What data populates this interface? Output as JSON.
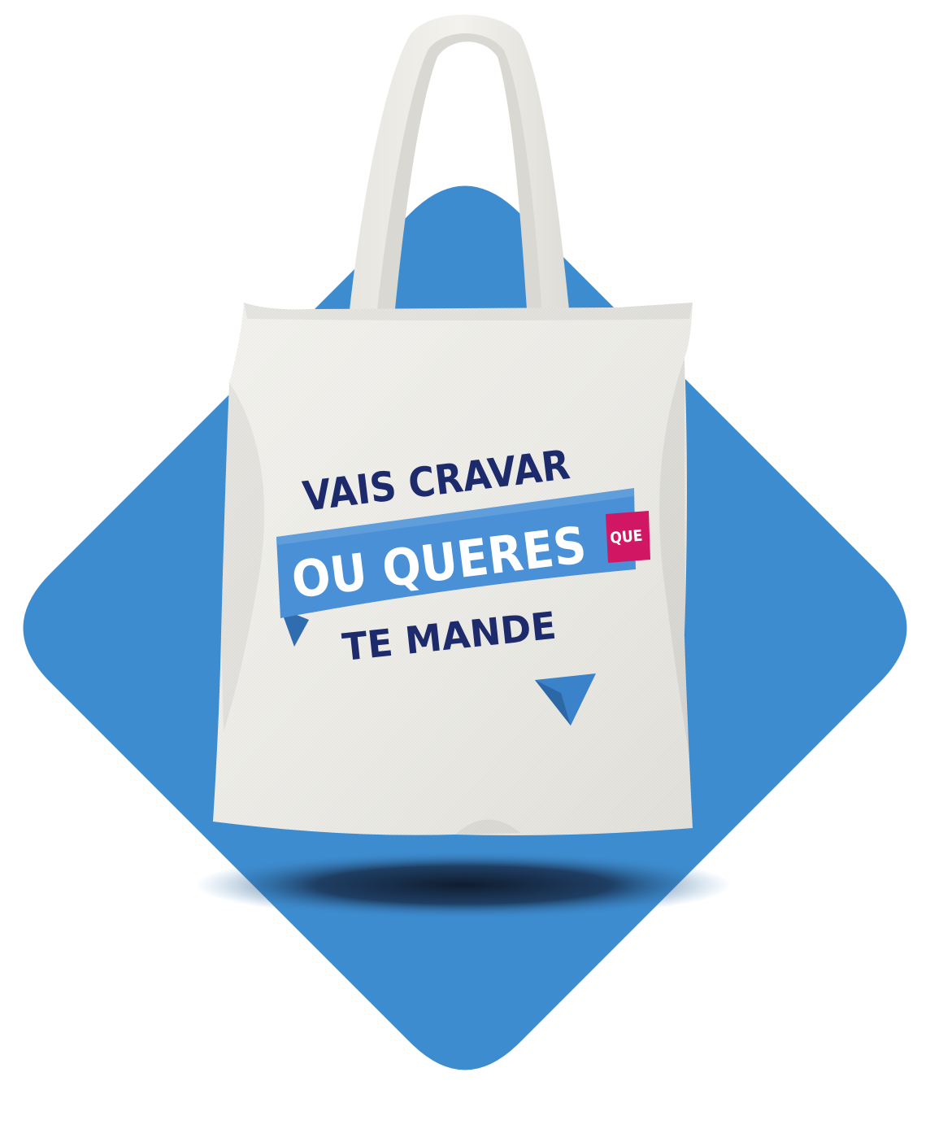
{
  "slogan": {
    "line1": "VAIS CRAVAR",
    "line2": "OU QUERES",
    "tag": "QUE",
    "line3": "TE MANDE"
  },
  "colors": {
    "diamond": "#3d8ccf",
    "bag": "#efeee9",
    "navy": "#1d2a6b",
    "ribbon": "#4a90d6",
    "ribbon_dark": "#2f6cb0",
    "tag": "#d11764",
    "arrow": "#3a82c9",
    "shadow": "#0e1626"
  },
  "icons": {
    "arrow": "paper-plane-arrow-icon"
  }
}
